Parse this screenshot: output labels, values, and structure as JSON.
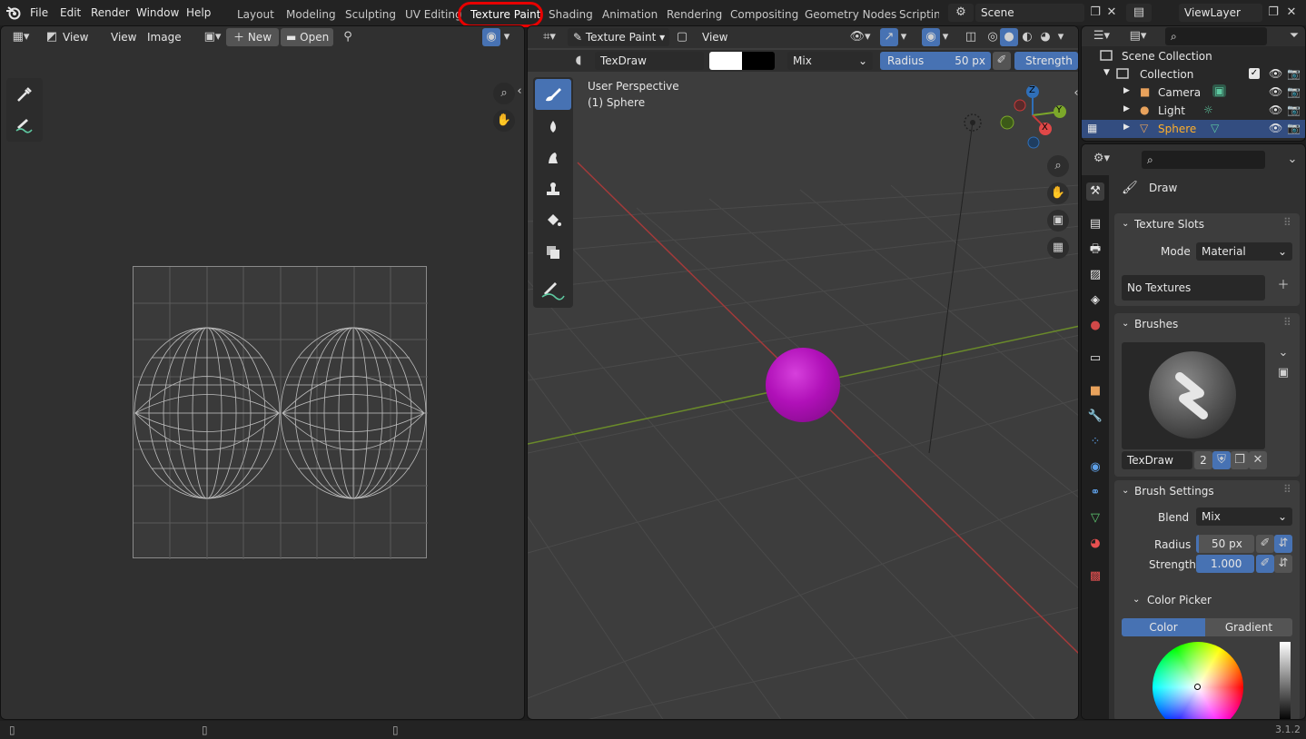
{
  "app": {
    "version": "3.1.2"
  },
  "menu": [
    "File",
    "Edit",
    "Render",
    "Window",
    "Help"
  ],
  "workspaces": [
    "Layout",
    "Modeling",
    "Sculpting",
    "UV Editing",
    "Texture Paint",
    "Shading",
    "Animation",
    "Rendering",
    "Compositing",
    "Geometry Nodes",
    "Scripting"
  ],
  "active_workspace": "Texture Paint",
  "scene": {
    "name": "Scene",
    "view_layer": "ViewLayer"
  },
  "image_editor": {
    "view_label": "View",
    "menu": [
      "View",
      "Image"
    ],
    "new_label": "New",
    "open_label": "Open"
  },
  "viewport": {
    "mode": "Texture Paint",
    "view_menu": "View",
    "brush_name": "TexDraw",
    "blend": "Mix",
    "radius_label": "Radius",
    "radius_value": "50 px",
    "strength_label": "Strength",
    "perspective": "User Perspective",
    "object_label": "(1) Sphere",
    "axis": {
      "x": "X",
      "y": "Y",
      "z": "Z"
    }
  },
  "outliner": {
    "scene_collection": "Scene Collection",
    "collection": "Collection",
    "items": [
      {
        "label": "Camera",
        "icon": "camera-icon",
        "color": "#e8a25c"
      },
      {
        "label": "Light",
        "icon": "light-icon",
        "color": "#e8a25c"
      },
      {
        "label": "Sphere",
        "icon": "mesh-icon",
        "color": "#e8a25c",
        "selected": true
      }
    ]
  },
  "properties": {
    "tool_name": "Draw",
    "texture_slots": {
      "title": "Texture Slots",
      "mode_label": "Mode",
      "mode_value": "Material",
      "empty": "No Textures"
    },
    "brushes": {
      "title": "Brushes",
      "brush_name": "TexDraw",
      "users": "2"
    },
    "brush_settings": {
      "title": "Brush Settings",
      "blend_label": "Blend",
      "blend_value": "Mix",
      "radius_label": "Radius",
      "radius_value": "50 px",
      "strength_label": "Strength",
      "strength_value": "1.000"
    },
    "color_picker": {
      "title": "Color Picker",
      "tabs": [
        "Color",
        "Gradient"
      ],
      "active_tab": "Color"
    }
  },
  "colors": {
    "accent": "#4772b3",
    "sphere": "#b010b8",
    "highlight": "#e80000"
  }
}
